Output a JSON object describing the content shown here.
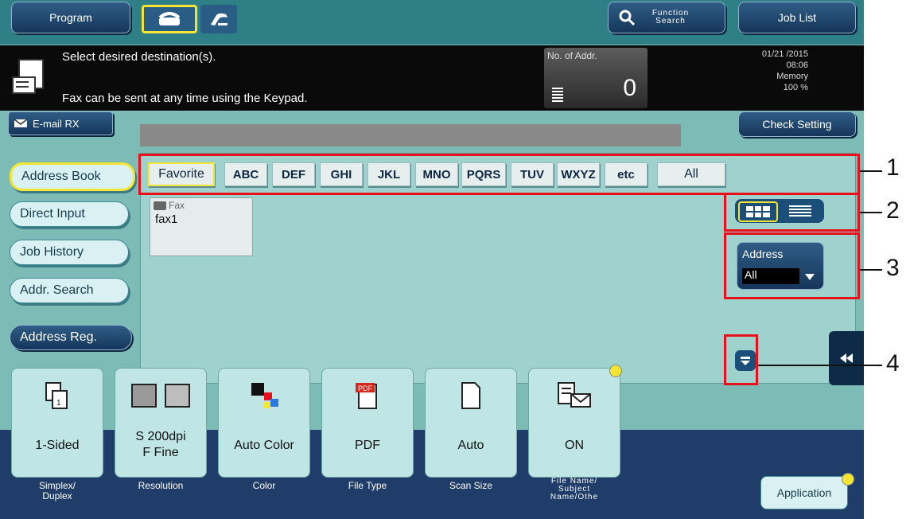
{
  "toolbar": {
    "program": "Program",
    "function_search": "Function Search",
    "job_list": "Job List"
  },
  "message": {
    "line1": "Select desired destination(s).",
    "line2": "Fax can be sent at any time using the Keypad.",
    "addr_label": "No. of Addr.",
    "addr_count": "0",
    "date": "01/21 /2015",
    "time": "08:06",
    "memory_label": "Memory",
    "memory_value": "100 %"
  },
  "email_rx": "E-mail RX",
  "check_setting": "Check Setting",
  "sidebar": [
    {
      "label": "Address Book"
    },
    {
      "label": "Direct Input"
    },
    {
      "label": "Job History"
    },
    {
      "label": "Addr. Search"
    },
    {
      "label": "Address Reg."
    }
  ],
  "index_tabs": [
    "Favorite",
    "ABC",
    "DEF",
    "GHI",
    "JKL",
    "MNO",
    "PQRS",
    "TUV",
    "WXYZ",
    "etc",
    "All"
  ],
  "entry": {
    "type": "Fax",
    "name": "fax1"
  },
  "address_filter": {
    "label": "Address",
    "value": "All"
  },
  "functions": [
    {
      "value": "1-Sided",
      "label": "Simplex/\nDuplex"
    },
    {
      "value": "S 200dpi\nF Fine",
      "label": "Resolution"
    },
    {
      "value": "Auto Color",
      "label": "Color"
    },
    {
      "value": "PDF",
      "label": "File Type"
    },
    {
      "value": "Auto",
      "label": "Scan Size"
    },
    {
      "value": "ON",
      "label": "File Name/\nSubject\nName/Othe"
    }
  ],
  "application": "Application",
  "callouts": [
    "1",
    "2",
    "3",
    "4"
  ],
  "colors": {
    "accent_yellow": "#f3e532",
    "callout_red": "#e8101a",
    "panel_teal": "#7dbcb6",
    "navy": "#1f3d68"
  }
}
